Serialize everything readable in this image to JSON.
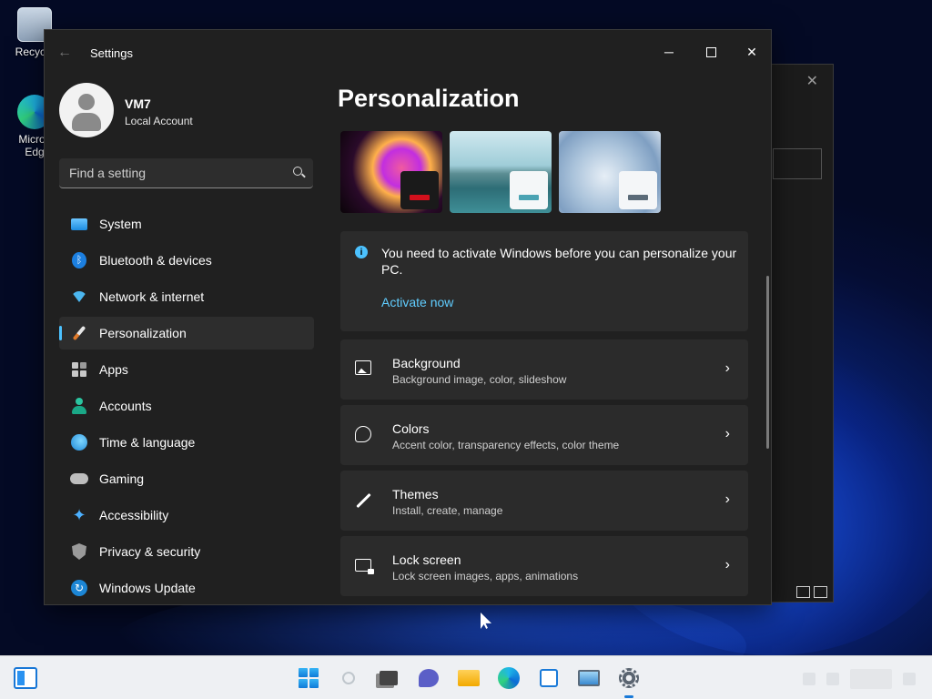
{
  "desktop": {
    "icons": [
      {
        "label": "Recycle",
        "icon": "recycle-bin-icon"
      },
      {
        "label": "Micros Edg",
        "icon": "edge-icon"
      }
    ]
  },
  "window": {
    "title": "Settings",
    "controls": {
      "minimize": "─",
      "close": "✕"
    }
  },
  "profile": {
    "name": "VM7",
    "account_type": "Local Account"
  },
  "search": {
    "placeholder": "Find a setting"
  },
  "nav": {
    "items": [
      {
        "label": "System",
        "icon": "system-icon"
      },
      {
        "label": "Bluetooth & devices",
        "icon": "bluetooth-icon"
      },
      {
        "label": "Network & internet",
        "icon": "wifi-icon"
      },
      {
        "label": "Personalization",
        "icon": "brush-icon",
        "active": true
      },
      {
        "label": "Apps",
        "icon": "apps-icon"
      },
      {
        "label": "Accounts",
        "icon": "person-icon"
      },
      {
        "label": "Time & language",
        "icon": "globe-icon"
      },
      {
        "label": "Gaming",
        "icon": "controller-icon"
      },
      {
        "label": "Accessibility",
        "icon": "accessibility-icon"
      },
      {
        "label": "Privacy & security",
        "icon": "shield-icon"
      },
      {
        "label": "Windows Update",
        "icon": "update-icon"
      }
    ]
  },
  "main": {
    "title": "Personalization",
    "themes": [
      "theme-glow",
      "theme-captured-motion",
      "theme-bloom"
    ],
    "notice": {
      "text": "You need to activate Windows before you can personalize your PC.",
      "link": "Activate now"
    },
    "cards": [
      {
        "title": "Background",
        "subtitle": "Background image, color, slideshow",
        "icon": "picture-icon"
      },
      {
        "title": "Colors",
        "subtitle": "Accent color, transparency effects, color theme",
        "icon": "palette-icon"
      },
      {
        "title": "Themes",
        "subtitle": "Install, create, manage",
        "icon": "pen-icon"
      },
      {
        "title": "Lock screen",
        "subtitle": "Lock screen images, apps, animations",
        "icon": "lock-screen-icon"
      }
    ]
  },
  "colors": {
    "accent": "#4cc2ff",
    "link": "#60cdff",
    "window_bg": "#202020",
    "card_bg": "#2b2b2b"
  }
}
